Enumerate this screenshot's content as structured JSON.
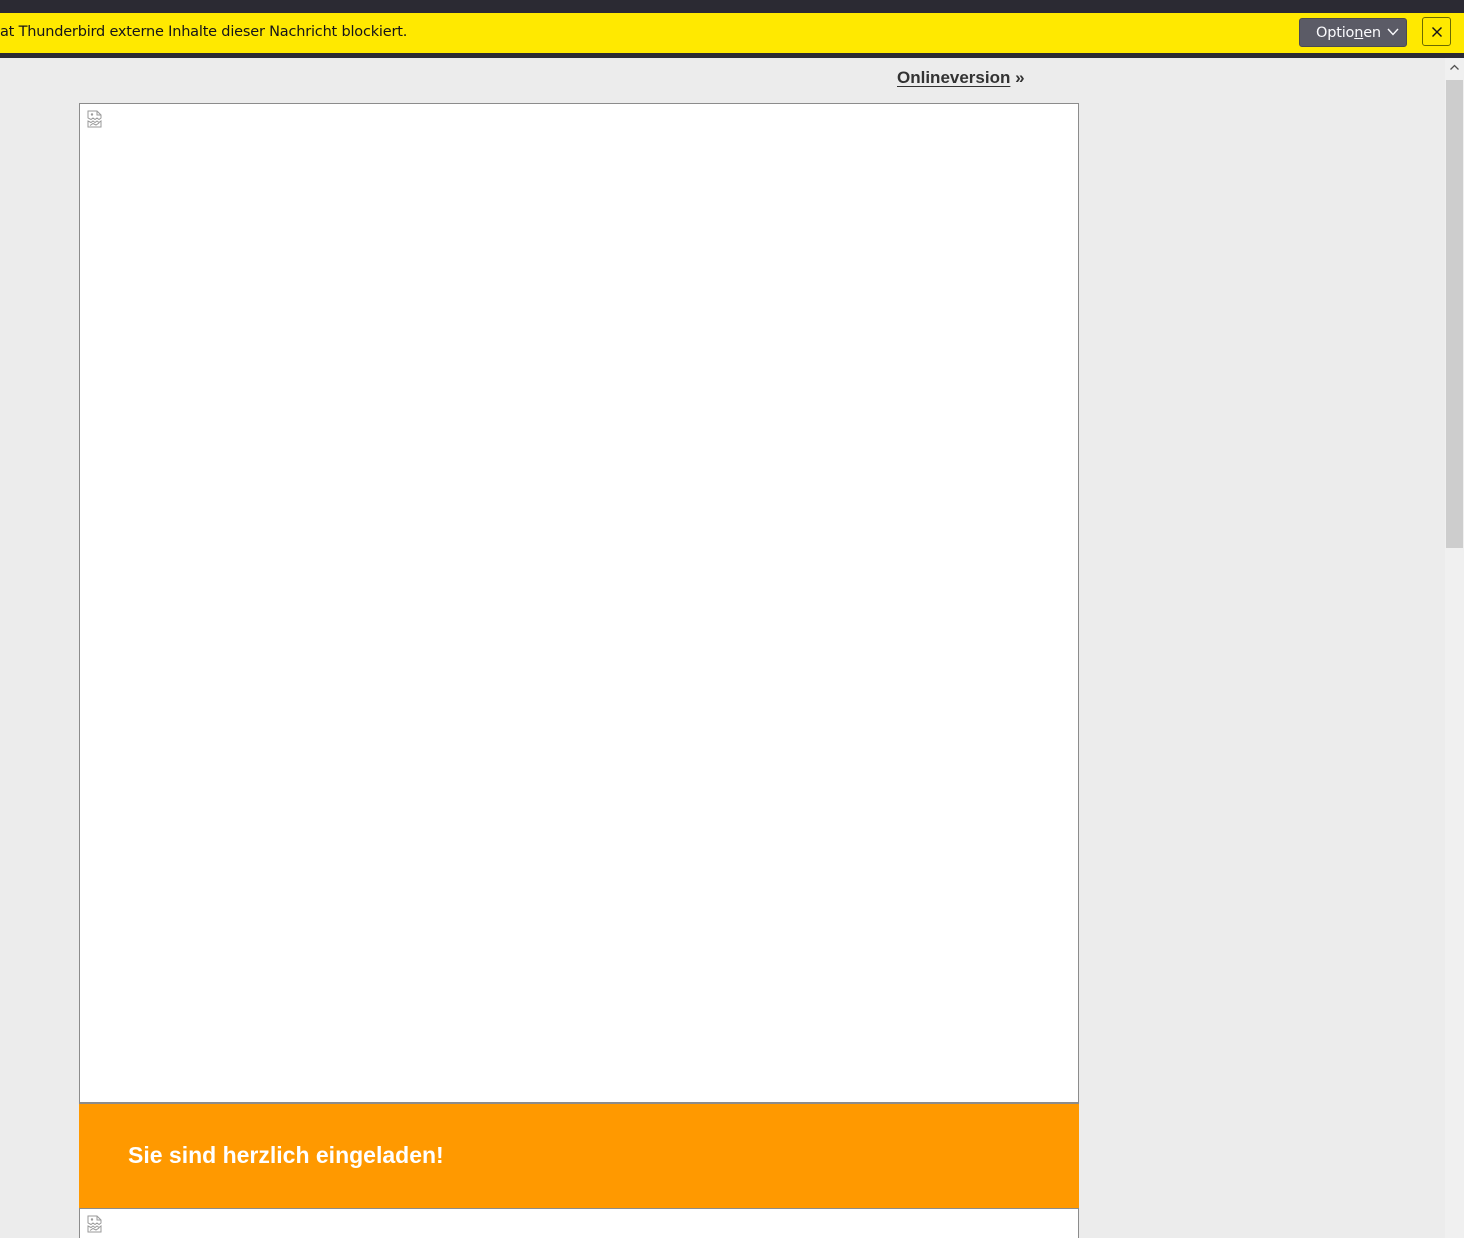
{
  "notification": {
    "message": "at Thunderbird externe Inhalte dieser Nachricht blockiert.",
    "options_label_pre": "Optio",
    "options_label_access": "n",
    "options_label_post": "en",
    "close_icon": "close-icon",
    "background_color": "#ffe900"
  },
  "message": {
    "online_link_label": "Onlineversion",
    "online_link_suffix": " »",
    "banner_text": "Sie sind herzlich eingeladen!",
    "banner_color": "#ff9900",
    "image_placeholder_icon": "broken-image-icon"
  },
  "scrollbar": {
    "up_icon": "chevron-up-icon"
  }
}
